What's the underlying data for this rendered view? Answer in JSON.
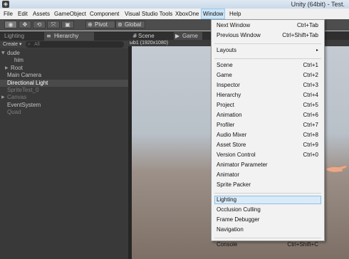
{
  "titlebar": {
    "logo_glyph": "◈",
    "title": "Unity (64bit) - Test."
  },
  "menubar": {
    "items": [
      "File",
      "Edit",
      "Assets",
      "GameObject",
      "Component",
      "Visual Studio Tools",
      "XboxOne",
      "Window",
      "Help"
    ],
    "active": "Window"
  },
  "toolbar": {
    "tools": [
      {
        "icon": "eye-icon",
        "glyph": "◉"
      },
      {
        "icon": "move-icon",
        "glyph": "✥"
      },
      {
        "icon": "rotate-icon",
        "glyph": "⟲"
      },
      {
        "icon": "scale-icon",
        "glyph": "⤧"
      },
      {
        "icon": "rect-icon",
        "glyph": "▣"
      }
    ],
    "pivot_glyph": "⊕",
    "pivot": "Pivot",
    "global_glyph": "⊛",
    "global": "Global"
  },
  "left_panel": {
    "tab_lighting": "Lighting",
    "tab_hierarchy_glyph": "≡",
    "tab_hierarchy": "Hierarchy",
    "create_label": "Create ▾",
    "search_glyph": "⌕",
    "search_placeholder": "All",
    "tree": [
      {
        "label": "dude",
        "indent": 0,
        "expanded": true,
        "state": "normal"
      },
      {
        "label": "him",
        "indent": 2,
        "expanded": null,
        "state": "normal"
      },
      {
        "label": "Root",
        "indent": 1,
        "expanded": false,
        "state": "normal"
      },
      {
        "label": "Main Camera",
        "indent": 0,
        "expanded": null,
        "state": "normal"
      },
      {
        "label": "Directional Light",
        "indent": 0,
        "expanded": null,
        "state": "selected"
      },
      {
        "label": "SpriteTest_0",
        "indent": 0,
        "expanded": null,
        "state": "dim"
      },
      {
        "label": "Canvas",
        "indent": 0,
        "expanded": false,
        "state": "dim"
      },
      {
        "label": "EventSystem",
        "indent": 0,
        "expanded": null,
        "state": "normal"
      },
      {
        "label": "Quad",
        "indent": 0,
        "expanded": null,
        "state": "dim"
      }
    ]
  },
  "scene_area": {
    "scene_tab_glyph": "#",
    "scene_tab": "Scene",
    "game_tab_glyph": "▶",
    "game_tab": "Game",
    "resolution": "ыb1 (1920x1080)"
  },
  "window_menu": {
    "items": [
      {
        "label": "Next Window",
        "shortcut": "Ctrl+Tab"
      },
      {
        "label": "Previous Window",
        "shortcut": "Ctrl+Shift+Tab"
      },
      {
        "separator": true
      },
      {
        "label": "Layouts",
        "submenu": "▸"
      },
      {
        "separator": true
      },
      {
        "label": "Scene",
        "shortcut": "Ctrl+1"
      },
      {
        "label": "Game",
        "shortcut": "Ctrl+2"
      },
      {
        "label": "Inspector",
        "shortcut": "Ctrl+3"
      },
      {
        "label": "Hierarchy",
        "shortcut": "Ctrl+4"
      },
      {
        "label": "Project",
        "shortcut": "Ctrl+5"
      },
      {
        "label": "Animation",
        "shortcut": "Ctrl+6"
      },
      {
        "label": "Profiler",
        "shortcut": "Ctrl+7"
      },
      {
        "label": "Audio Mixer",
        "shortcut": "Ctrl+8"
      },
      {
        "label": "Asset Store",
        "shortcut": "Ctrl+9"
      },
      {
        "label": "Version Control",
        "shortcut": "Ctrl+0"
      },
      {
        "label": "Animator Parameter"
      },
      {
        "label": "Animator"
      },
      {
        "label": "Sprite Packer"
      },
      {
        "separator": true
      },
      {
        "label": "Lighting",
        "highlight": true
      },
      {
        "label": "Occlusion Culling"
      },
      {
        "label": "Frame Debugger"
      },
      {
        "label": "Navigation"
      },
      {
        "separator": true
      },
      {
        "label": "Console",
        "shortcut": "Ctrl+Shift+C"
      }
    ]
  }
}
